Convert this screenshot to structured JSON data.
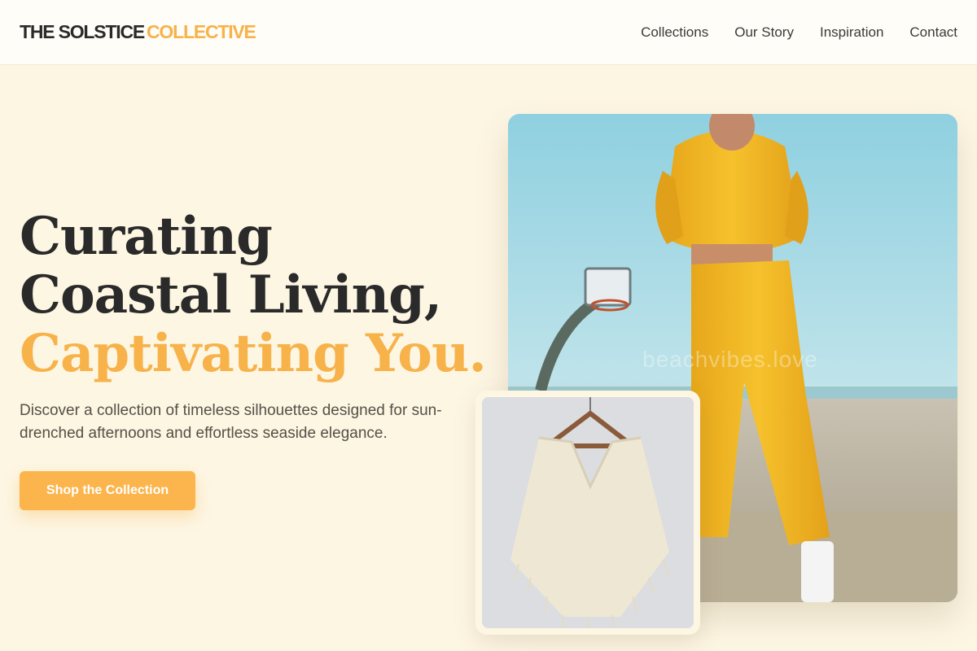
{
  "brand": {
    "name_part1": "THE SOLSTICE",
    "name_part2": "COLLECTIVE"
  },
  "nav": {
    "items": [
      {
        "label": "Collections"
      },
      {
        "label": "Our Story"
      },
      {
        "label": "Inspiration"
      },
      {
        "label": "Contact"
      }
    ]
  },
  "hero": {
    "headline_line1": "Curating",
    "headline_line2": "Coastal Living,",
    "headline_line3": "Captivating You.",
    "subtitle": "Discover a collection of timeless silhouettes designed for sun-drenched afternoons and effortless seaside elegance.",
    "cta_label": "Shop the Collection"
  },
  "images": {
    "main_watermark": "beachvibes.love"
  },
  "colors": {
    "background": "#fdf6e3",
    "accent": "#f7b24a",
    "text": "#2a2a2a"
  }
}
